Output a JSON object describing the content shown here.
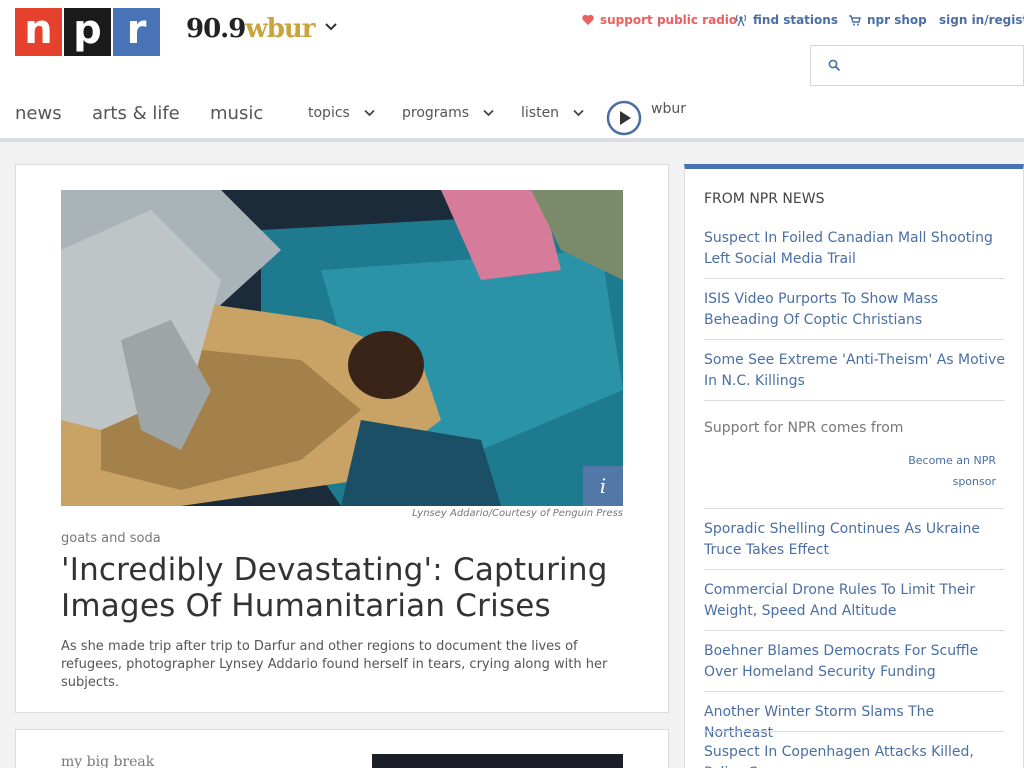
{
  "header": {
    "logo": {
      "n": "n",
      "p": "p",
      "r": "r"
    },
    "station": {
      "number": "90.9",
      "name": "wbur"
    },
    "utility": {
      "support": "support public radio",
      "find_stations": "find stations",
      "shop": "npr shop",
      "signin": "sign in/register"
    },
    "search": {
      "placeholder": ""
    },
    "nav": {
      "news": "news",
      "arts": "arts & life",
      "music": "music",
      "topics": "topics",
      "programs": "programs",
      "listen": "listen",
      "player_label": "wbur"
    }
  },
  "feature": {
    "image_credit": "Lynsey Addario/Courtesy of Penguin Press",
    "info_glyph": "i",
    "slug": "goats and soda",
    "headline": "'Incredibly Devastating': Capturing Images Of Humanitarian Crises",
    "teaser": "As she made trip after trip to Darfur and other regions to document the lives of refugees, photographer Lynsey Addario found herself in tears, crying along with her subjects."
  },
  "second": {
    "slug": "my big break"
  },
  "sidebar": {
    "title": "FROM NPR NEWS",
    "links_top": [
      "Suspect In Foiled Canadian Mall Shooting Left Social Media Trail",
      "ISIS Video Purports To Show Mass Beheading Of Coptic Christians",
      "Some See Extreme 'Anti-Theism' As Motive In N.C. Killings"
    ],
    "sponsor_title": "Support for NPR comes from",
    "sponsor_link": "Become an NPR sponsor",
    "links_bottom": [
      "Sporadic Shelling Continues As Ukraine Truce Takes Effect",
      "Commercial Drone Rules To Limit Their Weight, Speed And Altitude",
      "Boehner Blames Democrats For Scuffle Over Homeland Security Funding",
      "Another Winter Storm Slams The Northeast",
      "Suspect In Copenhagen Attacks Killed, Police Say"
    ]
  },
  "colors": {
    "npr_red": "#e5412c",
    "npr_black": "#1a1a1a",
    "npr_blue": "#4874b7",
    "link_blue": "#4a6fa5",
    "support_red": "#e8605f"
  },
  "icons": [
    "heart-icon",
    "radio-tower-icon",
    "cart-icon",
    "search-icon",
    "chevron-down-icon",
    "play-icon",
    "info-icon"
  ]
}
